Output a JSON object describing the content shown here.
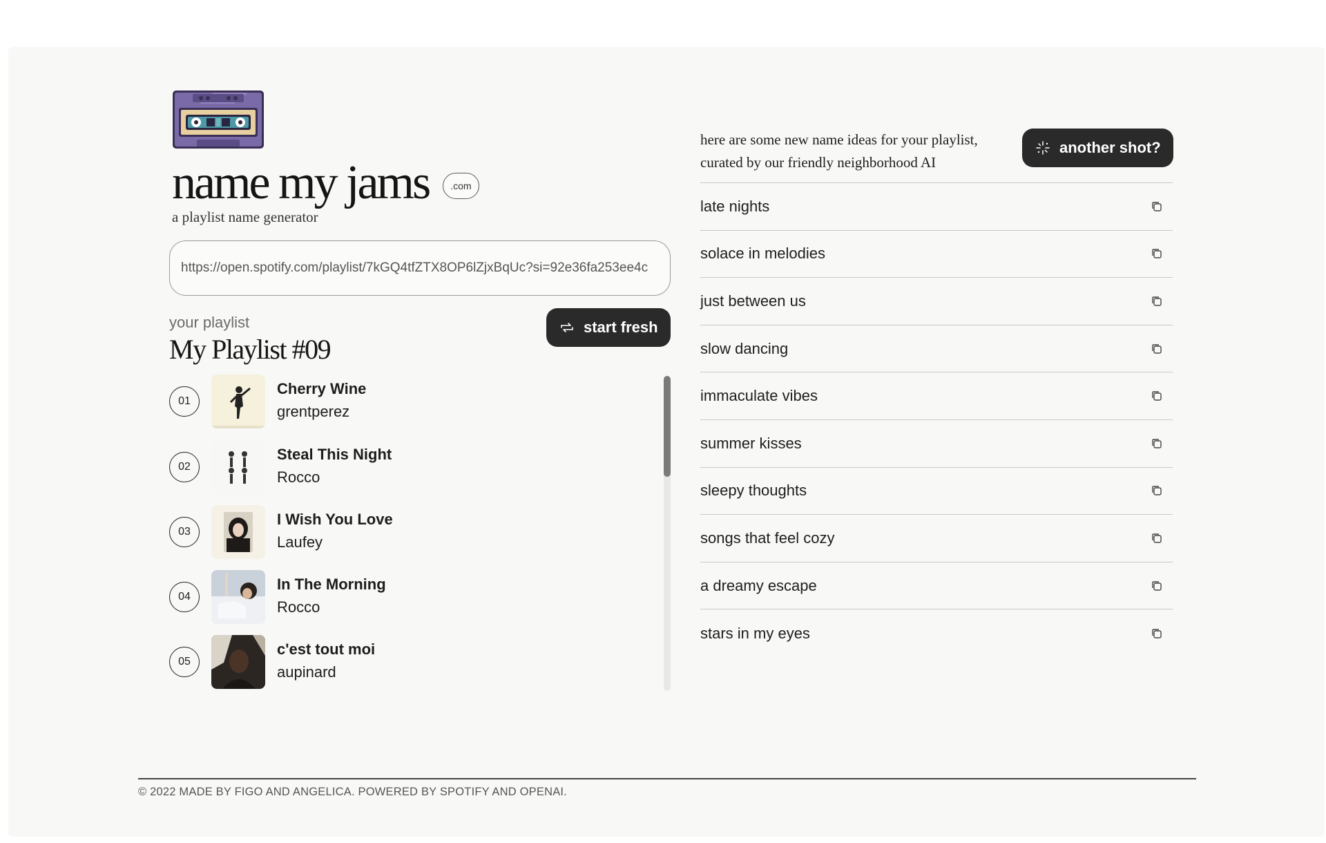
{
  "app": {
    "title": "name my jams",
    "domain_badge": ".com",
    "subtitle": "a playlist name generator"
  },
  "input": {
    "value": "https://open.spotify.com/playlist/7kGQ4tfZTX8OP6lZjxBqUc?si=92e36fa253ee4c",
    "placeholder": ""
  },
  "playlist": {
    "section_label": "your playlist",
    "name": "My Playlist #09",
    "start_fresh_label": "start fresh",
    "start_fresh_icon": "refresh-icon",
    "tracks": [
      {
        "num": "01",
        "title": "Cherry Wine",
        "artist": "grentperez"
      },
      {
        "num": "02",
        "title": "Steal This Night",
        "artist": "Rocco"
      },
      {
        "num": "03",
        "title": "I Wish You Love",
        "artist": "Laufey"
      },
      {
        "num": "04",
        "title": "In The Morning",
        "artist": "Rocco"
      },
      {
        "num": "05",
        "title": "c'est tout moi",
        "artist": "aupinard"
      }
    ]
  },
  "suggestions": {
    "intro": "here are some new name ideas for your playlist, curated by our friendly neighborhood AI",
    "another_shot_label": "another shot?",
    "another_shot_icon": "sparkle-icon",
    "copy_icon": "copy-icon",
    "names": [
      "late nights",
      "solace in melodies",
      "just between us",
      "slow dancing",
      "immaculate vibes",
      "summer kisses",
      "sleepy thoughts",
      "songs that feel cozy",
      "a dreamy escape",
      "stars in my eyes"
    ]
  },
  "footer": {
    "text": "© 2022 MADE BY FIGO AND ANGELICA. POWERED BY SPOTIFY AND OPENAI."
  },
  "colors": {
    "background": "#f8f8f6",
    "button": "#2a2a2a",
    "text": "#1d1d1d",
    "cassette_purple": "#7b6aa8",
    "cassette_label": "#e8cfa0",
    "cassette_window": "#4d9aa6"
  }
}
